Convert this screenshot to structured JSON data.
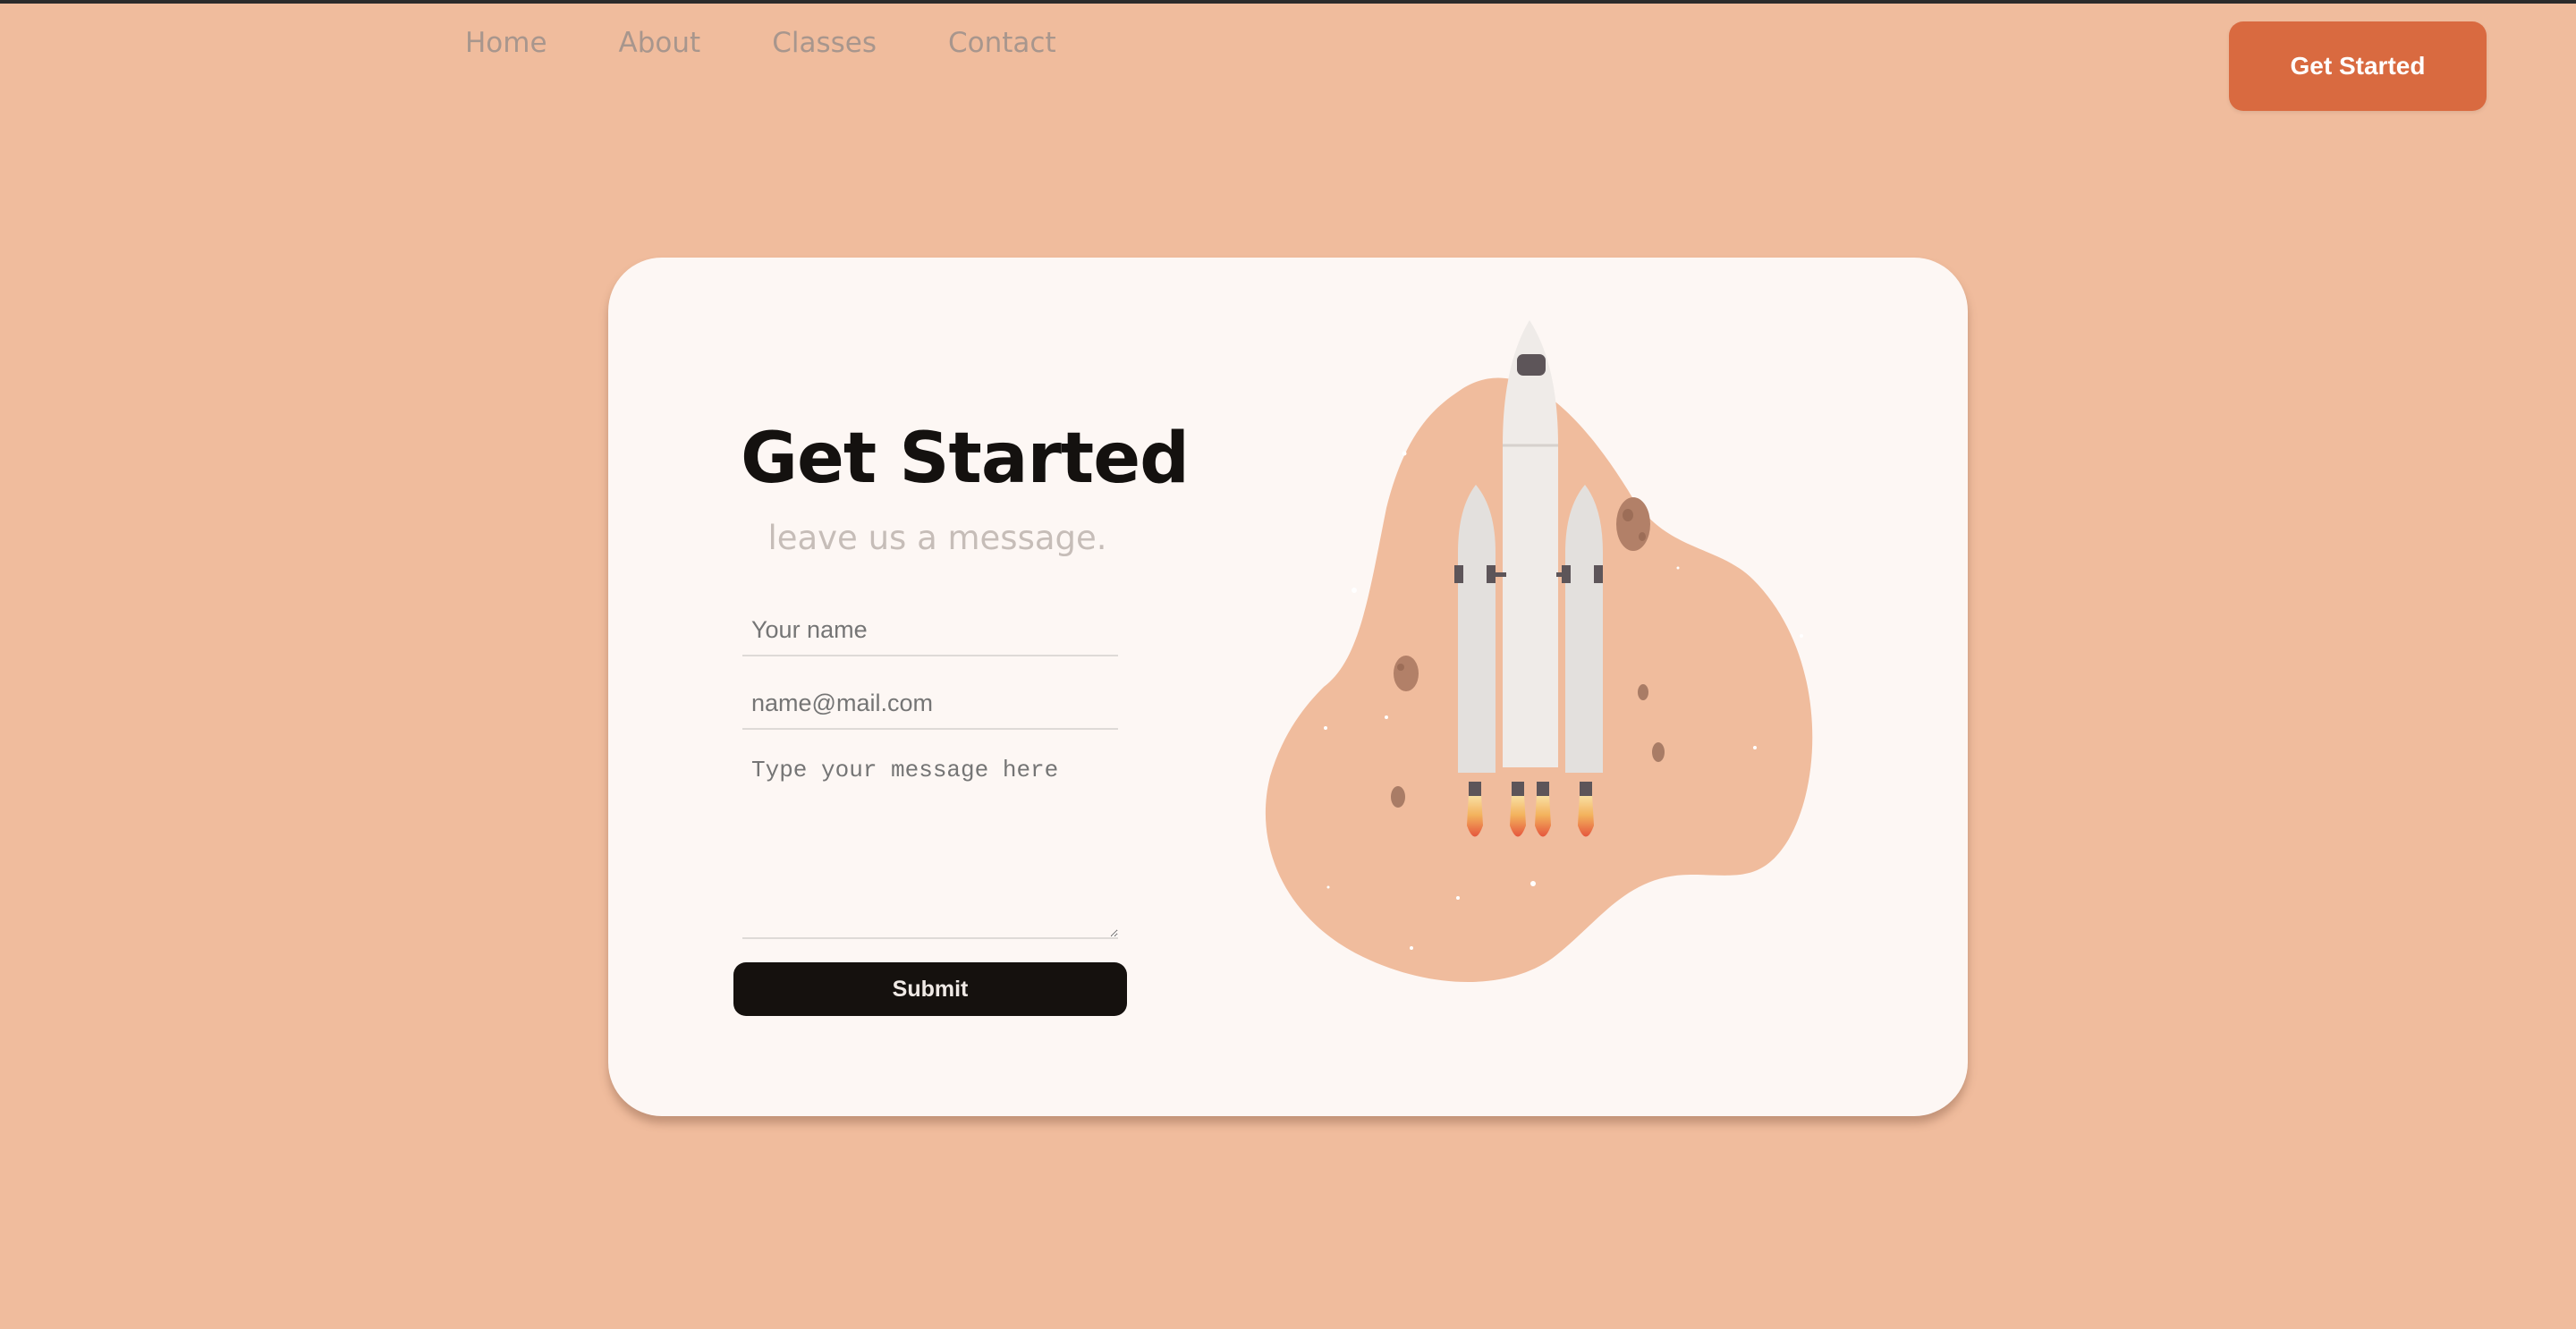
{
  "nav": {
    "items": [
      "Home",
      "About",
      "Classes",
      "Contact"
    ]
  },
  "header": {
    "cta_label": "Get Started"
  },
  "form": {
    "title": "Get Started",
    "subtitle": "leave us a message.",
    "name_placeholder": "Your name",
    "email_placeholder": "name@mail.com",
    "message_placeholder": "Type your message here",
    "submit_label": "Submit"
  },
  "colors": {
    "background": "#f0bc9d",
    "accent": "#d96a40",
    "card": "#fdf7f4",
    "text_dark": "#14110f"
  },
  "illustration": {
    "icon": "rocket-icon"
  }
}
